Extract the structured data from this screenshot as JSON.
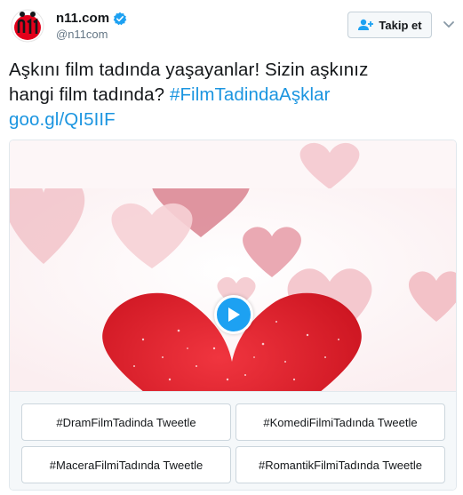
{
  "author": {
    "display_name": "n11.com",
    "handle": "@n11com",
    "avatar_text": "n11"
  },
  "follow_button": {
    "label": "Takip et"
  },
  "tweet": {
    "text_line1": "Aşkını film tadında yaşayanlar! Sizin aşkınız",
    "text_line2_plain": "hangi film tadında? ",
    "hashtag": "#FilmTadindaAşklar",
    "link": "goo.gl/QI5IIF"
  },
  "poll": {
    "options": [
      "#DramFilmTadinda Tweetle",
      "#KomediFilmiTadında Tweetle",
      "#MaceraFilmiTadında Tweetle",
      "#RomantikFilmiTadında Tweetle"
    ]
  },
  "colors": {
    "accent": "#1da1f2",
    "link": "#1b95e0",
    "heart_red": "#e0202c",
    "heart_pink": "#eaa4ae"
  },
  "icons": {
    "verified": "verified-badge-icon",
    "follow": "add-user-icon",
    "caret": "chevron-down-icon",
    "play": "play-icon"
  }
}
